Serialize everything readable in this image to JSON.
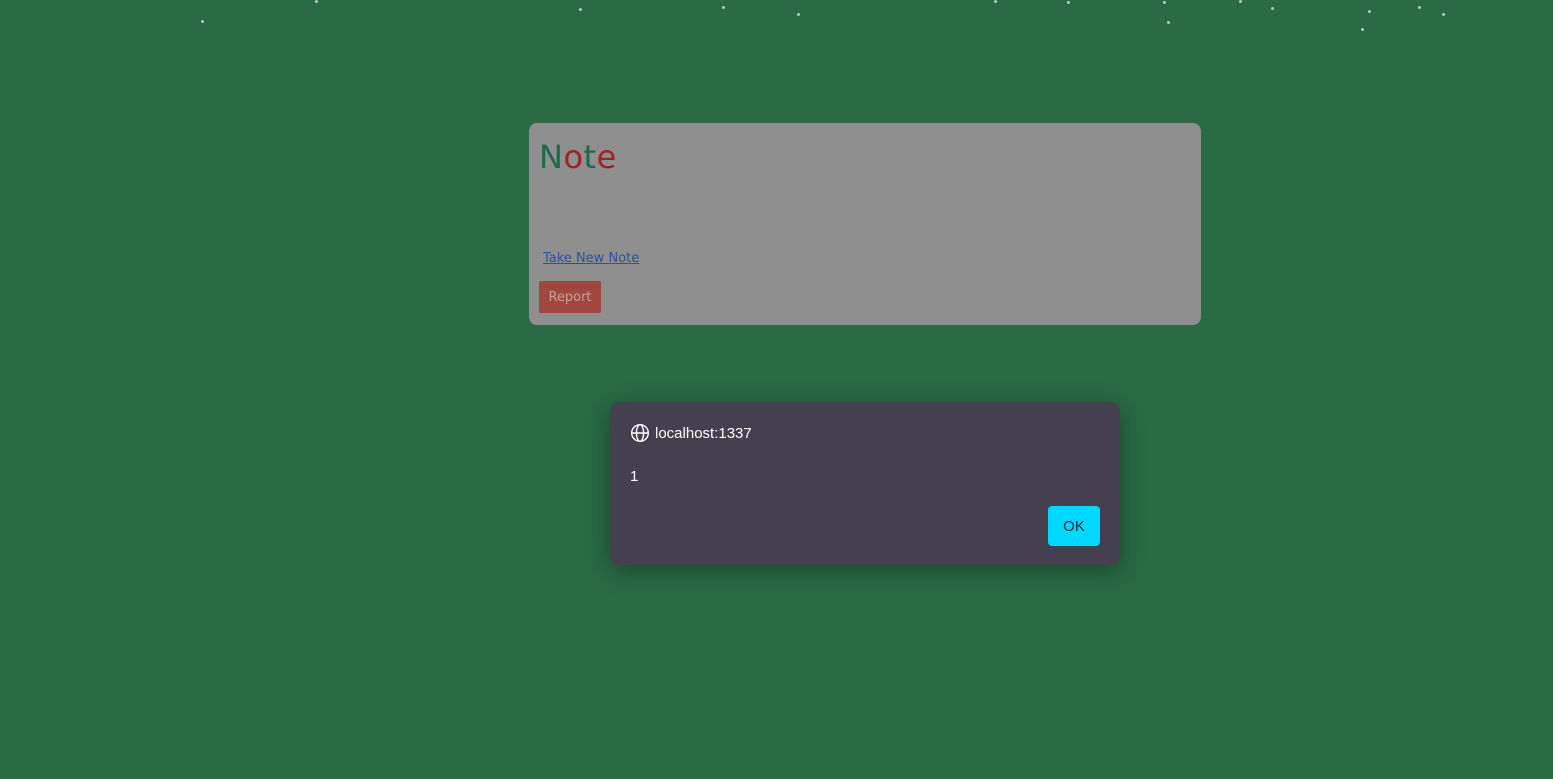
{
  "note_card": {
    "title_parts": [
      "N",
      "o",
      "t",
      "e"
    ],
    "take_new_note_link": "Take New Note",
    "report_button": "Report"
  },
  "alert_dialog": {
    "origin": "localhost:1337",
    "message": "1",
    "ok_button": "OK"
  },
  "colors": {
    "background": "#2a6a45",
    "card": "#8f8f90",
    "title_green": "#1e6a44",
    "title_red": "#9b2525",
    "report_button": "#a0473f",
    "dialog": "#44404f",
    "ok_button": "#00d8ff"
  },
  "icons": {
    "dialog_origin": "globe-icon"
  }
}
